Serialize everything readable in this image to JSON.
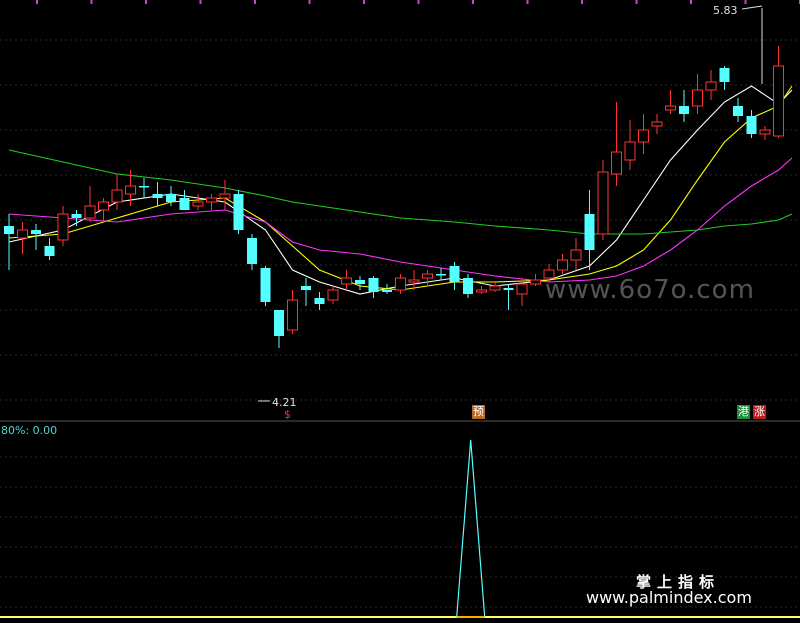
{
  "chart_data": {
    "type": "candlestick",
    "title": "",
    "price_panel": {
      "ylim": [
        3.85,
        5.95
      ],
      "max_label": "5.83",
      "min_label": "4.21",
      "candles": [
        {
          "o": 4.82,
          "h": 4.88,
          "l": 4.6,
          "c": 4.78,
          "dir": "down"
        },
        {
          "o": 4.76,
          "h": 4.84,
          "l": 4.68,
          "c": 4.8,
          "dir": "up"
        },
        {
          "o": 4.8,
          "h": 4.83,
          "l": 4.7,
          "c": 4.78,
          "dir": "down"
        },
        {
          "o": 4.72,
          "h": 4.76,
          "l": 4.65,
          "c": 4.67,
          "dir": "down"
        },
        {
          "o": 4.75,
          "h": 4.92,
          "l": 4.72,
          "c": 4.88,
          "dir": "up"
        },
        {
          "o": 4.88,
          "h": 4.9,
          "l": 4.82,
          "c": 4.86,
          "dir": "down"
        },
        {
          "o": 4.86,
          "h": 5.02,
          "l": 4.84,
          "c": 4.92,
          "dir": "up"
        },
        {
          "o": 4.9,
          "h": 4.96,
          "l": 4.84,
          "c": 4.94,
          "dir": "up"
        },
        {
          "o": 4.94,
          "h": 5.08,
          "l": 4.9,
          "c": 5.0,
          "dir": "up"
        },
        {
          "o": 5.02,
          "h": 5.1,
          "l": 4.92,
          "c": 4.98,
          "dir": "up"
        },
        {
          "o": 5.02,
          "h": 5.06,
          "l": 4.96,
          "c": 5.02,
          "dir": "down"
        },
        {
          "o": 4.98,
          "h": 5.04,
          "l": 4.92,
          "c": 4.96,
          "dir": "down"
        },
        {
          "o": 4.98,
          "h": 5.02,
          "l": 4.92,
          "c": 4.94,
          "dir": "down"
        },
        {
          "o": 4.96,
          "h": 5.0,
          "l": 4.9,
          "c": 4.9,
          "dir": "down"
        },
        {
          "o": 4.92,
          "h": 4.98,
          "l": 4.9,
          "c": 4.94,
          "dir": "up"
        },
        {
          "o": 4.94,
          "h": 4.98,
          "l": 4.9,
          "c": 4.96,
          "dir": "up"
        },
        {
          "o": 4.96,
          "h": 5.05,
          "l": 4.9,
          "c": 4.98,
          "dir": "up"
        },
        {
          "o": 4.98,
          "h": 5.0,
          "l": 4.78,
          "c": 4.8,
          "dir": "down"
        },
        {
          "o": 4.76,
          "h": 4.78,
          "l": 4.6,
          "c": 4.63,
          "dir": "down"
        },
        {
          "o": 4.61,
          "h": 4.62,
          "l": 4.42,
          "c": 4.44,
          "dir": "down"
        },
        {
          "o": 4.4,
          "h": 4.4,
          "l": 4.21,
          "c": 4.27,
          "dir": "down"
        },
        {
          "o": 4.3,
          "h": 4.5,
          "l": 4.28,
          "c": 4.45,
          "dir": "up"
        },
        {
          "o": 4.5,
          "h": 4.56,
          "l": 4.42,
          "c": 4.52,
          "dir": "down"
        },
        {
          "o": 4.46,
          "h": 4.49,
          "l": 4.4,
          "c": 4.43,
          "dir": "down"
        },
        {
          "o": 4.45,
          "h": 4.52,
          "l": 4.43,
          "c": 4.5,
          "dir": "up"
        },
        {
          "o": 4.53,
          "h": 4.6,
          "l": 4.5,
          "c": 4.56,
          "dir": "up"
        },
        {
          "o": 4.55,
          "h": 4.57,
          "l": 4.5,
          "c": 4.53,
          "dir": "down"
        },
        {
          "o": 4.56,
          "h": 4.57,
          "l": 4.46,
          "c": 4.49,
          "dir": "down"
        },
        {
          "o": 4.5,
          "h": 4.53,
          "l": 4.48,
          "c": 4.49,
          "dir": "down"
        },
        {
          "o": 4.5,
          "h": 4.58,
          "l": 4.48,
          "c": 4.56,
          "dir": "up"
        },
        {
          "o": 4.54,
          "h": 4.6,
          "l": 4.5,
          "c": 4.55,
          "dir": "up"
        },
        {
          "o": 4.56,
          "h": 4.6,
          "l": 4.52,
          "c": 4.58,
          "dir": "up"
        },
        {
          "o": 4.58,
          "h": 4.61,
          "l": 4.55,
          "c": 4.58,
          "dir": "down"
        },
        {
          "o": 4.62,
          "h": 4.64,
          "l": 4.5,
          "c": 4.54,
          "dir": "down"
        },
        {
          "o": 4.56,
          "h": 4.58,
          "l": 4.46,
          "c": 4.48,
          "dir": "down"
        },
        {
          "o": 4.49,
          "h": 4.52,
          "l": 4.48,
          "c": 4.5,
          "dir": "up"
        },
        {
          "o": 4.5,
          "h": 4.54,
          "l": 4.49,
          "c": 4.52,
          "dir": "up"
        },
        {
          "o": 4.51,
          "h": 4.53,
          "l": 4.4,
          "c": 4.5,
          "dir": "down"
        },
        {
          "o": 4.48,
          "h": 4.56,
          "l": 4.42,
          "c": 4.53,
          "dir": "up"
        },
        {
          "o": 4.53,
          "h": 4.58,
          "l": 4.52,
          "c": 4.55,
          "dir": "up"
        },
        {
          "o": 4.56,
          "h": 4.63,
          "l": 4.54,
          "c": 4.6,
          "dir": "up"
        },
        {
          "o": 4.6,
          "h": 4.68,
          "l": 4.58,
          "c": 4.65,
          "dir": "up"
        },
        {
          "o": 4.65,
          "h": 4.76,
          "l": 4.6,
          "c": 4.7,
          "dir": "up"
        },
        {
          "o": 4.7,
          "h": 5.0,
          "l": 4.6,
          "c": 4.88,
          "dir": "down"
        },
        {
          "o": 4.78,
          "h": 5.15,
          "l": 4.75,
          "c": 5.09,
          "dir": "up"
        },
        {
          "o": 5.08,
          "h": 5.44,
          "l": 5.02,
          "c": 5.19,
          "dir": "up"
        },
        {
          "o": 5.15,
          "h": 5.35,
          "l": 5.1,
          "c": 5.24,
          "dir": "up"
        },
        {
          "o": 5.24,
          "h": 5.38,
          "l": 5.18,
          "c": 5.3,
          "dir": "up"
        },
        {
          "o": 5.32,
          "h": 5.38,
          "l": 5.28,
          "c": 5.34,
          "dir": "up"
        },
        {
          "o": 5.4,
          "h": 5.5,
          "l": 5.38,
          "c": 5.42,
          "dir": "up"
        },
        {
          "o": 5.38,
          "h": 5.5,
          "l": 5.34,
          "c": 5.42,
          "dir": "down"
        },
        {
          "o": 5.42,
          "h": 5.58,
          "l": 5.38,
          "c": 5.5,
          "dir": "up"
        },
        {
          "o": 5.5,
          "h": 5.6,
          "l": 5.45,
          "c": 5.54,
          "dir": "up"
        },
        {
          "o": 5.61,
          "h": 5.62,
          "l": 5.5,
          "c": 5.54,
          "dir": "down"
        },
        {
          "o": 5.42,
          "h": 5.46,
          "l": 5.34,
          "c": 5.37,
          "dir": "down"
        },
        {
          "o": 5.37,
          "h": 5.4,
          "l": 5.26,
          "c": 5.28,
          "dir": "down"
        },
        {
          "o": 5.3,
          "h": 5.32,
          "l": 5.25,
          "c": 5.28,
          "dir": "up"
        },
        {
          "o": 5.27,
          "h": 5.72,
          "l": 5.26,
          "c": 5.62,
          "dir": "up"
        }
      ],
      "ma_lines": [
        {
          "color": "#ffffff",
          "points": [
            [
              0,
              4.74
            ],
            [
              4,
              4.8
            ],
            [
              8,
              4.94
            ],
            [
              12,
              4.98
            ],
            [
              16,
              4.94
            ],
            [
              19,
              4.8
            ],
            [
              21,
              4.6
            ],
            [
              23,
              4.54
            ],
            [
              26,
              4.48
            ],
            [
              29,
              4.52
            ],
            [
              33,
              4.56
            ],
            [
              36,
              4.52
            ],
            [
              40,
              4.55
            ],
            [
              43,
              4.62
            ],
            [
              45,
              4.75
            ],
            [
              47,
              4.95
            ],
            [
              49,
              5.15
            ],
            [
              51,
              5.3
            ],
            [
              53,
              5.44
            ],
            [
              55,
              5.52
            ],
            [
              57,
              5.43
            ],
            [
              58,
              5.5
            ]
          ]
        },
        {
          "color": "#ffff00",
          "points": [
            [
              0,
              4.76
            ],
            [
              4,
              4.78
            ],
            [
              8,
              4.86
            ],
            [
              12,
              4.94
            ],
            [
              16,
              4.96
            ],
            [
              19,
              4.84
            ],
            [
              21,
              4.72
            ],
            [
              23,
              4.6
            ],
            [
              26,
              4.52
            ],
            [
              29,
              4.5
            ],
            [
              33,
              4.54
            ],
            [
              36,
              4.54
            ],
            [
              40,
              4.55
            ],
            [
              43,
              4.58
            ],
            [
              45,
              4.62
            ],
            [
              47,
              4.7
            ],
            [
              49,
              4.85
            ],
            [
              51,
              5.05
            ],
            [
              53,
              5.24
            ],
            [
              55,
              5.36
            ],
            [
              57,
              5.42
            ],
            [
              58,
              5.52
            ]
          ]
        },
        {
          "color": "#ff33ff",
          "points": [
            [
              0,
              4.88
            ],
            [
              4,
              4.86
            ],
            [
              8,
              4.84
            ],
            [
              12,
              4.88
            ],
            [
              16,
              4.9
            ],
            [
              19,
              4.84
            ],
            [
              21,
              4.74
            ],
            [
              23,
              4.7
            ],
            [
              26,
              4.68
            ],
            [
              29,
              4.64
            ],
            [
              33,
              4.6
            ],
            [
              36,
              4.57
            ],
            [
              40,
              4.54
            ],
            [
              43,
              4.55
            ],
            [
              45,
              4.57
            ],
            [
              47,
              4.62
            ],
            [
              49,
              4.7
            ],
            [
              51,
              4.8
            ],
            [
              53,
              4.92
            ],
            [
              55,
              5.02
            ],
            [
              57,
              5.1
            ],
            [
              58,
              5.16
            ]
          ]
        },
        {
          "color": "#22cc22",
          "points": [
            [
              0,
              5.2
            ],
            [
              4,
              5.14
            ],
            [
              8,
              5.08
            ],
            [
              12,
              5.05
            ],
            [
              16,
              5.01
            ],
            [
              19,
              4.97
            ],
            [
              21,
              4.94
            ],
            [
              23,
              4.92
            ],
            [
              26,
              4.89
            ],
            [
              29,
              4.86
            ],
            [
              33,
              4.84
            ],
            [
              36,
              4.82
            ],
            [
              40,
              4.8
            ],
            [
              43,
              4.78
            ],
            [
              45,
              4.78
            ],
            [
              47,
              4.78
            ],
            [
              49,
              4.79
            ],
            [
              51,
              4.8
            ],
            [
              53,
              4.82
            ],
            [
              55,
              4.83
            ],
            [
              57,
              4.85
            ],
            [
              58,
              4.88
            ]
          ]
        }
      ]
    },
    "indicator_panel": {
      "label": "80%: 0.00",
      "ylim": [
        0,
        1
      ],
      "spike": {
        "x": 34.2,
        "value": 1
      }
    },
    "markers": {
      "s_tag": "$",
      "yu_tag": "预",
      "gang_tag": "港",
      "zhang_tag": "涨"
    },
    "colors": {
      "up": "#ff3333",
      "down": "#55ffff",
      "grid": "#2a2a2a",
      "indicator_line": "#55ffff",
      "baseline": "#ffff66"
    }
  },
  "watermarks": {
    "big": "www.6o7o.com",
    "cn": "掌上指标",
    "url": "www.palmindex.com"
  }
}
